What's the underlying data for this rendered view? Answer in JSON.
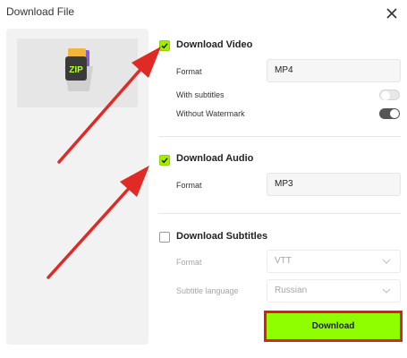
{
  "dialog": {
    "title": "Download File",
    "close_icon": "close-icon"
  },
  "preview": {
    "icon": "zip-file-icon",
    "icon_label": "ZIP"
  },
  "video": {
    "title": "Download Video",
    "checked": true,
    "format_label": "Format",
    "format_value": "MP4",
    "subtitles_label": "With subtitles",
    "subtitles_on": false,
    "watermark_label": "Without Watermark",
    "watermark_on": true
  },
  "audio": {
    "title": "Download Audio",
    "checked": true,
    "format_label": "Format",
    "format_value": "MP3"
  },
  "subtitles": {
    "title": "Download Subtitles",
    "checked": false,
    "format_label": "Format",
    "format_value": "VTT",
    "language_label": "Subtitle language",
    "language_value": "Russian"
  },
  "actions": {
    "download_label": "Download"
  },
  "colors": {
    "accent": "#8fff00",
    "highlight_border": "#d9201b",
    "arrow": "#e02a25"
  }
}
